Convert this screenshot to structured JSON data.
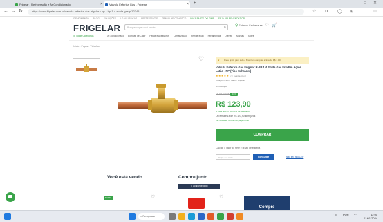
{
  "colors": {
    "brand_green": "#3aa44a",
    "navy": "#2b3540",
    "blue": "#1f5fb5",
    "banner_yellow": "#fbf0c4"
  },
  "browser": {
    "tabs": [
      {
        "title": "Frigelar - Refrigeração e Ar Condicionado",
        "active": false
      },
      {
        "title": "Válvula Esférica Gás - Frigelar",
        "active": true
      }
    ],
    "url": "https://www.frigelar.com.br/valvula-esferica-dos-frigelar-r-pp-r-hp-1-4-solda-gas/p/12345",
    "window_controls": [
      "—",
      "□",
      "✕"
    ]
  },
  "site": {
    "top_links": [
      "ATENDIMENTO",
      "BLOG",
      "SOLUÇÕES",
      "LOJAS FÍSICAS",
      "FRETE GRÁTIS",
      "TRABALHE CONOSCO"
    ],
    "top_right_links": [
      "FAÇA PARTE DO TIME",
      "SEJA UM REVENDEDOR"
    ],
    "logo": "FRIGELAR",
    "search_placeholder": "Busque o que você precisa",
    "account_label": "Entre ou Cadastre-se",
    "all_categories": "Todas Categorias",
    "categories": [
      "Ar-condicionado",
      "Bombas de Calor",
      "Peças e Acessórios",
      "Climatização",
      "Refrigeração",
      "Ferramentas",
      "Ofertas",
      "Marcas",
      "Sobre"
    ]
  },
  "breadcrumb": [
    "Início",
    "Peças",
    "Válvulas"
  ],
  "product": {
    "banner": "Frete grátis para todo o Brasil em compras acima de R$ 1.000",
    "title": "Válvula Esférica Gás Frigelar R-PP 1/4 Solda Gás Fria Em Aço e Latão - PP (Tipo Schrader)",
    "stars": "★★★★★",
    "rating_count": "(0 avaliações)",
    "code": "Código: 12345 | Marca: Frigelar",
    "stock": "Em estoque",
    "old_price": "De R$ 145,90",
    "discount": "-15%",
    "price": "R$ 123,90",
    "pix_text": "à vista no PIX com 5% de desconto",
    "installments": "Ou em até 1x de R$ 123,90 sem juros",
    "installments_link": "Ver todas as formas de pagamento",
    "buy_label": "COMPRAR",
    "shipping_text": "Calcule o valor do frete e prazo de entrega",
    "cep_placeholder": "Digite seu CEP",
    "consult_label": "Consultar",
    "dont_know_cep": "Não sei meu CEP"
  },
  "sections": {
    "seeing": "Você está vendo",
    "buy_together": "Compre junto",
    "rating_bar": "★ Avaliar produto",
    "compare_label": "Compre",
    "badge": "NOVO"
  },
  "taskbar": {
    "search_placeholder": "Pesquisar",
    "lang": "POR",
    "time": "12:00",
    "date": "01/01/2024"
  }
}
